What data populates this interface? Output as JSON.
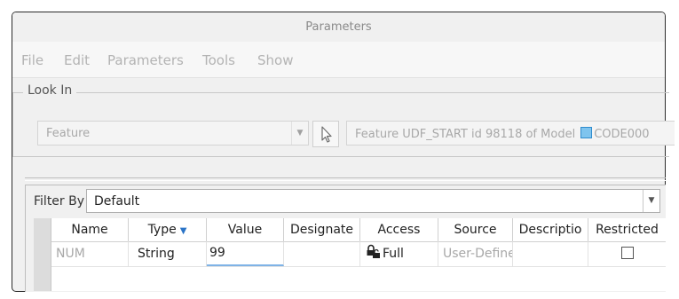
{
  "window": {
    "title": "Parameters"
  },
  "menu": [
    "File",
    "Edit",
    "Parameters",
    "Tools",
    "Show"
  ],
  "look_in": {
    "legend": "Look In",
    "combo_value": "Feature",
    "selection_text": "Feature UDF_START id 98118 of Model",
    "model_name": "CODE000"
  },
  "filter": {
    "label": "Filter By",
    "value": "Default"
  },
  "table": {
    "headers": [
      "Name",
      "Type",
      "Value",
      "Designate",
      "Access",
      "Source",
      "Descriptio",
      "Restricted"
    ],
    "row": {
      "name": "NUM",
      "type": "String",
      "value": "99",
      "designate": "",
      "access": "Full",
      "source": "User-Define",
      "description": "",
      "restricted": false
    }
  },
  "colors": {
    "accent": "#2b74c7",
    "part_icon": "#7fc4ee",
    "edit_underline": "#7fb3e6"
  },
  "icons": [
    "arrow-pointer-icon",
    "part-icon",
    "lock-icon",
    "sort-filter-icon",
    "dropdown-arrow-icon"
  ]
}
